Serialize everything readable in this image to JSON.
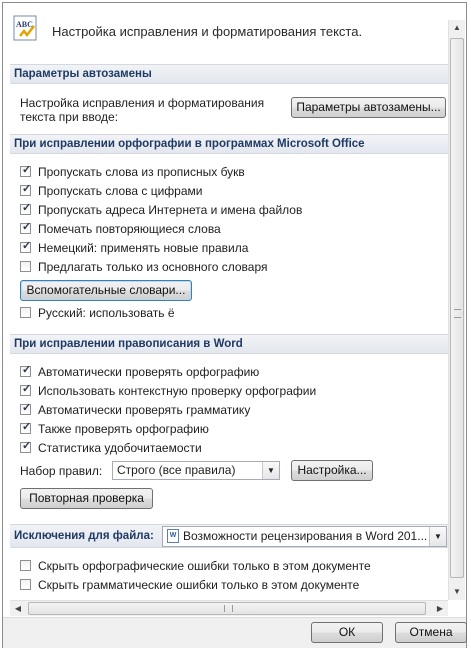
{
  "header": {
    "icon": "abc-spellcheck-icon",
    "title": "Настройка исправления и форматирования текста."
  },
  "autocorrect": {
    "section_title": "Параметры автозамены",
    "description_line1": "Настройка исправления и форматирования",
    "description_line2": "текста при вводе:",
    "button_label": "Параметры автозамены..."
  },
  "office_spelling": {
    "section_title": "При исправлении орфографии в программах Microsoft Office",
    "options": [
      {
        "label": "Пропускать слова из прописных букв",
        "checked": true
      },
      {
        "label": "Пропускать слова с цифрами",
        "checked": true
      },
      {
        "label": "Пропускать адреса Интернета и имена файлов",
        "checked": true
      },
      {
        "label": "Помечать повторяющиеся слова",
        "checked": true
      },
      {
        "label": "Немецкий: применять новые правила",
        "checked": true
      },
      {
        "label": "Предлагать только из основного словаря",
        "checked": false
      }
    ],
    "dictionaries_button": "Вспомогательные словари...",
    "russian_option": {
      "label": "Русский: использовать ё",
      "checked": false
    }
  },
  "word_spelling": {
    "section_title": "При исправлении правописания в Word",
    "options": [
      {
        "label": "Автоматически проверять орфографию",
        "checked": true
      },
      {
        "label": "Использовать контекстную проверку орфографии",
        "checked": true
      },
      {
        "label": "Автоматически проверять грамматику",
        "checked": true
      },
      {
        "label": "Также проверять орфографию",
        "checked": true
      },
      {
        "label": "Статистика удобочитаемости",
        "checked": true
      }
    ],
    "ruleset_label": "Набор правил:",
    "ruleset_value": "Строго (все правила)",
    "settings_button": "Настройка...",
    "recheck_button": "Повторная проверка"
  },
  "exceptions": {
    "section_title": "Исключения для файла:",
    "file_value": "Возможности рецензирования в Word 201...",
    "options": [
      {
        "label": "Скрыть орфографические ошибки только в этом документе",
        "checked": false
      },
      {
        "label": "Скрыть грамматические ошибки только в этом документе",
        "checked": false
      }
    ]
  },
  "footer": {
    "ok_label": "ОК",
    "cancel_label": "Отмена"
  },
  "colors": {
    "section_text": "#1f3a64",
    "focus_border": "#3c7fb1"
  }
}
